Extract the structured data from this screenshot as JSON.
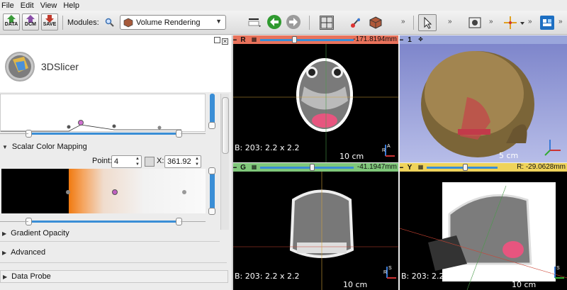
{
  "menu": {
    "file": "File",
    "edit": "Edit",
    "view": "View",
    "help": "Help"
  },
  "toolbar": {
    "data_label": "DATA",
    "dcm_label": "DCM",
    "save_label": "SAVE",
    "modules_label": "Modules:",
    "module_selected": "Volume Rendering"
  },
  "logo": {
    "title": "3DSlicer"
  },
  "panel": {
    "scalar_color_mapping": "Scalar Color Mapping",
    "point_label": "Point:",
    "point_value": "4",
    "x_label": "X:",
    "x_value": "361.92",
    "gradient_opacity": "Gradient Opacity",
    "advanced": "Advanced",
    "data_probe": "Data Probe"
  },
  "views": {
    "red": {
      "letter": "R",
      "offset": "-171.8194mm",
      "info": "B: 203: 2.2 x 2.2",
      "scale": "10 cm",
      "color": "#e9725b"
    },
    "threed": {
      "letter": "1",
      "scale": "5 cm",
      "color": "#9aa6dc"
    },
    "green": {
      "letter": "G",
      "offset": "-41.1947mm",
      "info": "B: 203: 2.2 x 2.2",
      "scale": "10 cm",
      "color": "#7fc77a"
    },
    "yellow": {
      "letter": "Y",
      "offset": "R: -29.0628mm",
      "info": "B: 203: 2.2 x 2.2",
      "scale": "10 cm",
      "color": "#efd35b"
    }
  }
}
